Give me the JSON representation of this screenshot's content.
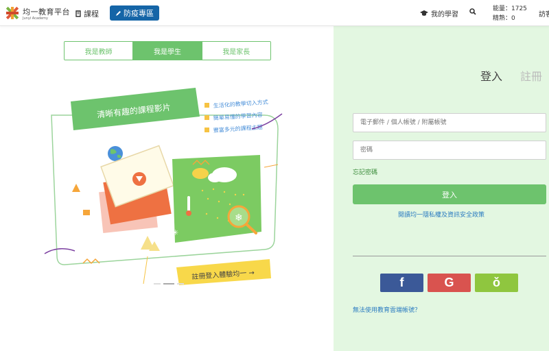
{
  "header": {
    "logo_title": "均一教育平台",
    "logo_sub": "Junyi Academy",
    "nav_course": "課程",
    "nav_epidemic": "防疫專區",
    "nav_mylearn": "我的學習",
    "energy_label": "能量：1725",
    "skill_label": "精熟：0",
    "visitor": "訪客"
  },
  "roles": {
    "teacher": "我是教師",
    "student": "我是學生",
    "parent": "我是家長"
  },
  "banner": {
    "title": "清晰有趣的課程影片",
    "point1": "生活化的教學切入方式",
    "point2": "簡單易懂的學習內容",
    "point3": "豐富多元的課程主題",
    "cta": "註冊登入體驗均一 →"
  },
  "auth": {
    "login_tab": "登入",
    "register_tab": "註冊",
    "email_placeholder": "電子郵件 / 個人帳號 / 附屬帳號",
    "password_placeholder": "密碼",
    "forgot": "忘記密碼",
    "login_button": "登入",
    "privacy": "閱讀均一隱私權及資訊安全政策",
    "facebook": "f",
    "google": "G",
    "other": "ǒ",
    "cant_use": "無法使用教育雲端帳號？"
  },
  "colors": {
    "brand_green": "#6dc36d",
    "nav_blue": "#1565a7",
    "panel_bg": "#e3f7e1",
    "facebook": "#3b5998",
    "google": "#d9534f",
    "other": "#8fc63f"
  },
  "icons": {
    "course": "book-icon",
    "epidemic": "pencil-icon",
    "mylearn": "graduation-cap-icon",
    "search": "search-icon"
  }
}
